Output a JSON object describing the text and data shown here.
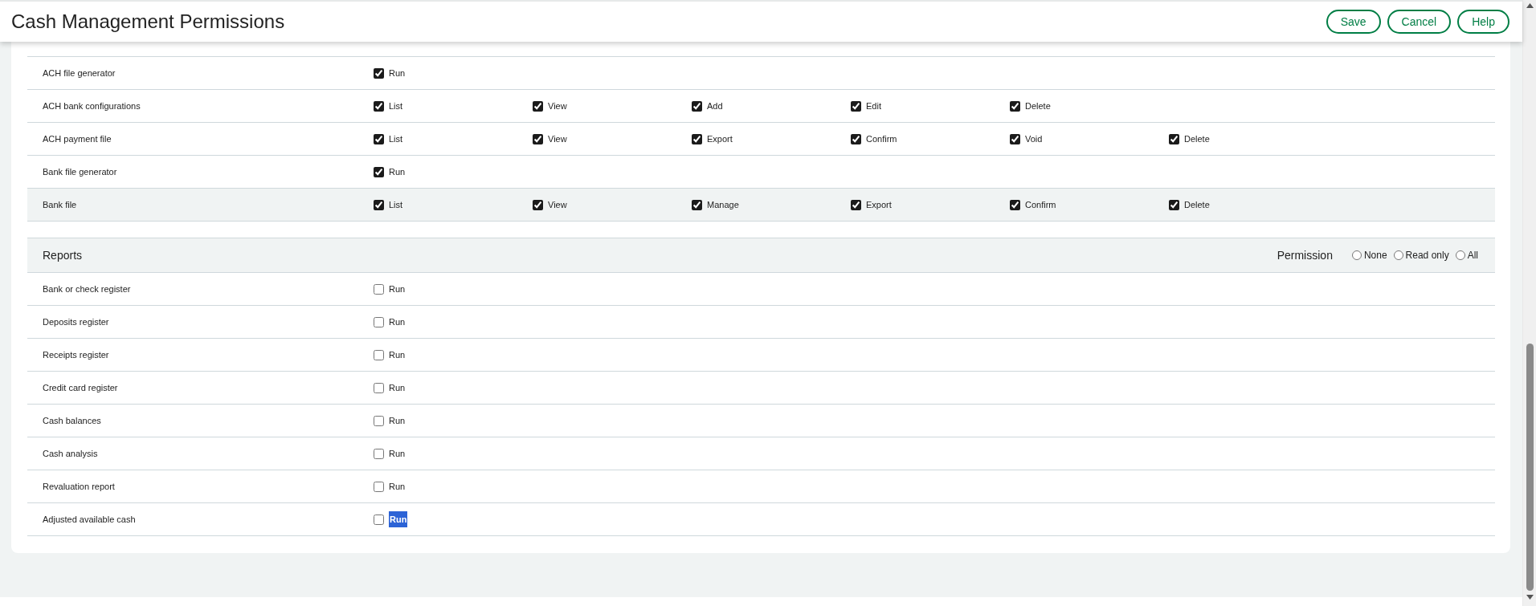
{
  "header": {
    "title": "Cash Management Permissions",
    "buttons": [
      "Save",
      "Cancel",
      "Help"
    ]
  },
  "sections": [
    {
      "rows": [
        {
          "label": "ACH file generator",
          "hovered": false,
          "options": [
            {
              "label": "Run",
              "checked": true,
              "highlighted": false
            }
          ]
        },
        {
          "label": "ACH bank configurations",
          "hovered": false,
          "options": [
            {
              "label": "List",
              "checked": true,
              "highlighted": false
            },
            {
              "label": "View",
              "checked": true,
              "highlighted": false
            },
            {
              "label": "Add",
              "checked": true,
              "highlighted": false
            },
            {
              "label": "Edit",
              "checked": true,
              "highlighted": false
            },
            {
              "label": "Delete",
              "checked": true,
              "highlighted": false
            }
          ]
        },
        {
          "label": "ACH payment file",
          "hovered": false,
          "options": [
            {
              "label": "List",
              "checked": true,
              "highlighted": false
            },
            {
              "label": "View",
              "checked": true,
              "highlighted": false
            },
            {
              "label": "Export",
              "checked": true,
              "highlighted": false
            },
            {
              "label": "Confirm",
              "checked": true,
              "highlighted": false
            },
            {
              "label": "Void",
              "checked": true,
              "highlighted": false
            },
            {
              "label": "Delete",
              "checked": true,
              "highlighted": false
            }
          ]
        },
        {
          "label": "Bank file generator",
          "hovered": false,
          "options": [
            {
              "label": "Run",
              "checked": true,
              "highlighted": false
            }
          ]
        },
        {
          "label": "Bank file",
          "hovered": true,
          "options": [
            {
              "label": "List",
              "checked": true,
              "highlighted": false
            },
            {
              "label": "View",
              "checked": true,
              "highlighted": false
            },
            {
              "label": "Manage",
              "checked": true,
              "highlighted": false
            },
            {
              "label": "Export",
              "checked": true,
              "highlighted": false
            },
            {
              "label": "Confirm",
              "checked": true,
              "highlighted": false
            },
            {
              "label": "Delete",
              "checked": true,
              "highlighted": false
            }
          ]
        }
      ]
    },
    {
      "title": "Reports",
      "permission": {
        "label": "Permission",
        "choices": [
          {
            "label": "None",
            "selected": false
          },
          {
            "label": "Read only",
            "selected": false
          },
          {
            "label": "All",
            "selected": false
          }
        ]
      },
      "rows": [
        {
          "label": "Bank or check register",
          "hovered": false,
          "options": [
            {
              "label": "Run",
              "checked": false,
              "highlighted": false
            }
          ]
        },
        {
          "label": "Deposits register",
          "hovered": false,
          "options": [
            {
              "label": "Run",
              "checked": false,
              "highlighted": false
            }
          ]
        },
        {
          "label": "Receipts register",
          "hovered": false,
          "options": [
            {
              "label": "Run",
              "checked": false,
              "highlighted": false
            }
          ]
        },
        {
          "label": "Credit card register",
          "hovered": false,
          "options": [
            {
              "label": "Run",
              "checked": false,
              "highlighted": false
            }
          ]
        },
        {
          "label": "Cash balances",
          "hovered": false,
          "options": [
            {
              "label": "Run",
              "checked": false,
              "highlighted": false
            }
          ]
        },
        {
          "label": "Cash analysis",
          "hovered": false,
          "options": [
            {
              "label": "Run",
              "checked": false,
              "highlighted": false
            }
          ]
        },
        {
          "label": "Revaluation report",
          "hovered": false,
          "options": [
            {
              "label": "Run",
              "checked": false,
              "highlighted": false
            }
          ]
        },
        {
          "label": "Adjusted available cash",
          "hovered": false,
          "options": [
            {
              "label": "Run",
              "checked": false,
              "highlighted": true
            }
          ]
        }
      ]
    }
  ]
}
